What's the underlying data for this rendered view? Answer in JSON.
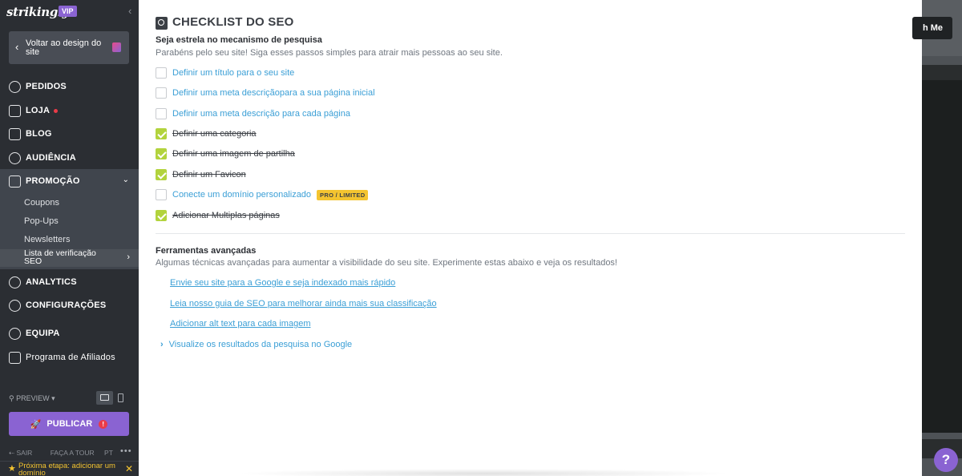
{
  "sidebar": {
    "logo": "strikingly",
    "vip": "VIP",
    "back_label": "Voltar ao design do site",
    "nav": [
      {
        "label": "PEDIDOS",
        "icon": "dollar-icon"
      },
      {
        "label": "LOJA",
        "icon": "store-icon"
      },
      {
        "label": "BLOG",
        "icon": "feather-icon"
      },
      {
        "label": "AUDIÊNCIA",
        "icon": "people-icon"
      },
      {
        "label": "PROMOÇÃO",
        "icon": "megaphone-icon"
      },
      {
        "label": "ANALYTICS",
        "icon": "chart-icon"
      },
      {
        "label": "CONFIGURAÇÕES",
        "icon": "gear-icon"
      },
      {
        "label": "EQUIPA",
        "icon": "team-icon"
      },
      {
        "label": "Programa de Afiliados",
        "icon": "trophy-icon"
      }
    ],
    "promo_sub": [
      "Coupons",
      "Pop-Ups",
      "Newsletters",
      "Lista de verificação SEO"
    ],
    "preview_label": "PREVIEW",
    "publish_label": "PUBLICAR",
    "footer": {
      "exit": "SAIR",
      "tour": "FAÇA A TOUR",
      "lang": "PT",
      "more": "•••"
    },
    "next_step": "Próxima etapa: adicionar um domínio"
  },
  "main": {
    "title": "CHECKLIST DO SEO",
    "heading": "Seja estrela no mecanismo de pesquisa",
    "subheading": "Parabéns pelo seu site! Siga esses passos simples para atrair mais pessoas ao seu site.",
    "checklist": [
      {
        "label": "Definir um título para o seu site",
        "checked": false
      },
      {
        "label": "Definir uma meta descriçãopara a sua página inicial",
        "checked": false
      },
      {
        "label": "Definir uma meta descrição para cada página",
        "checked": false
      },
      {
        "label": "Definir uma categoria",
        "checked": true
      },
      {
        "label": "Definir uma imagem de partilha",
        "checked": true
      },
      {
        "label": "Definir um Favicon",
        "checked": true
      },
      {
        "label": "Conecte um domínio personalizado",
        "checked": false,
        "badge": "PRO / LIMITED"
      },
      {
        "label": "Adicionar Multiplas páginas",
        "checked": true
      }
    ],
    "advanced": {
      "title": "Ferramentas avançadas",
      "subtitle": "Algumas técnicas avançadas para aumentar a visibilidade do seu site. Experimente estas abaixo e veja os resultados!",
      "links": [
        "Envie seu site para a Google e seja indexado mais rápido",
        "Leia nosso guia de SEO para melhorar ainda mais sua classificação",
        "Adicionar alt text para cada imagem"
      ],
      "expand": "Visualize os resultados da pesquisa no Google"
    }
  },
  "background": {
    "button_fragment": "h Me",
    "help": "?"
  },
  "colors": {
    "sidebar_bg": "#2b2e33",
    "accent": "#8a63d2",
    "link": "#3b9fd6",
    "check_on": "#b2d33d",
    "badge": "#f4c430"
  }
}
